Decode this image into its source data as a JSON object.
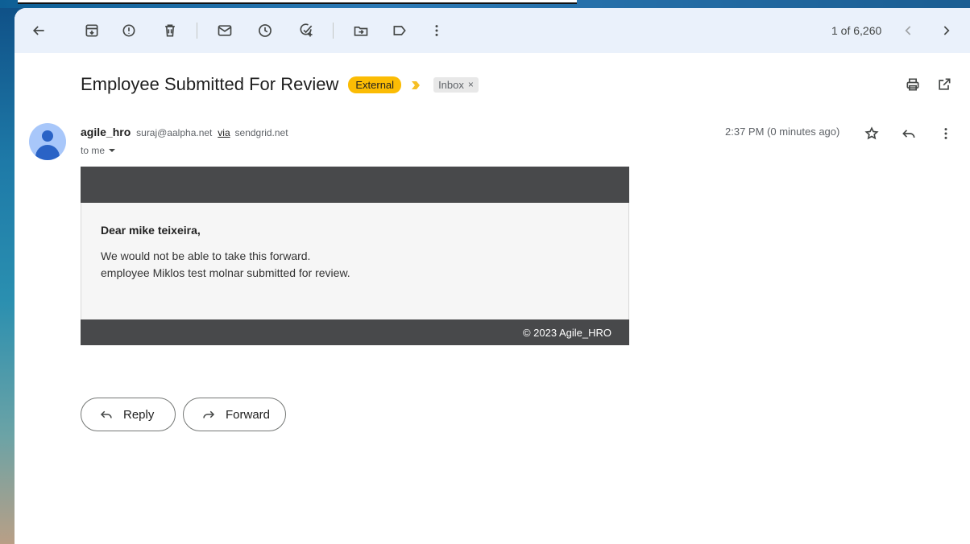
{
  "toolbar": {
    "counter": "1 of 6,260",
    "icons": [
      "back-arrow-icon",
      "archive-icon",
      "report-spam-icon",
      "delete-icon",
      "mark-unread-icon",
      "snooze-icon",
      "add-to-tasks-icon",
      "move-to-icon",
      "label-icon",
      "more-vert-icon",
      "newer-chevron-icon",
      "older-chevron-icon"
    ]
  },
  "message": {
    "subject": "Employee Submitted For Review",
    "external_label": "External",
    "inbox_label": "Inbox",
    "inbox_remove": "×",
    "sender_name": "agile_hro",
    "sender_email": "suraj@aalpha.net",
    "via_word": "via",
    "via_domain": "sendgrid.net",
    "to_line": "to me",
    "timestamp": "2:37 PM (0 minutes ago)"
  },
  "email_body": {
    "greeting": "Dear mike teixeira,",
    "line1": "We would not be able to take this forward.",
    "line2": "employee Miklos test molnar submitted for review.",
    "footer": "© 2023 Agile_HRO"
  },
  "actions": {
    "reply_label": "Reply",
    "forward_label": "Forward"
  },
  "colors": {
    "toolbar_bg": "#eaf1fb",
    "external_badge": "#fbbc04",
    "email_header_footer": "#48494b",
    "avatar_bg": "#a8c7fa"
  }
}
